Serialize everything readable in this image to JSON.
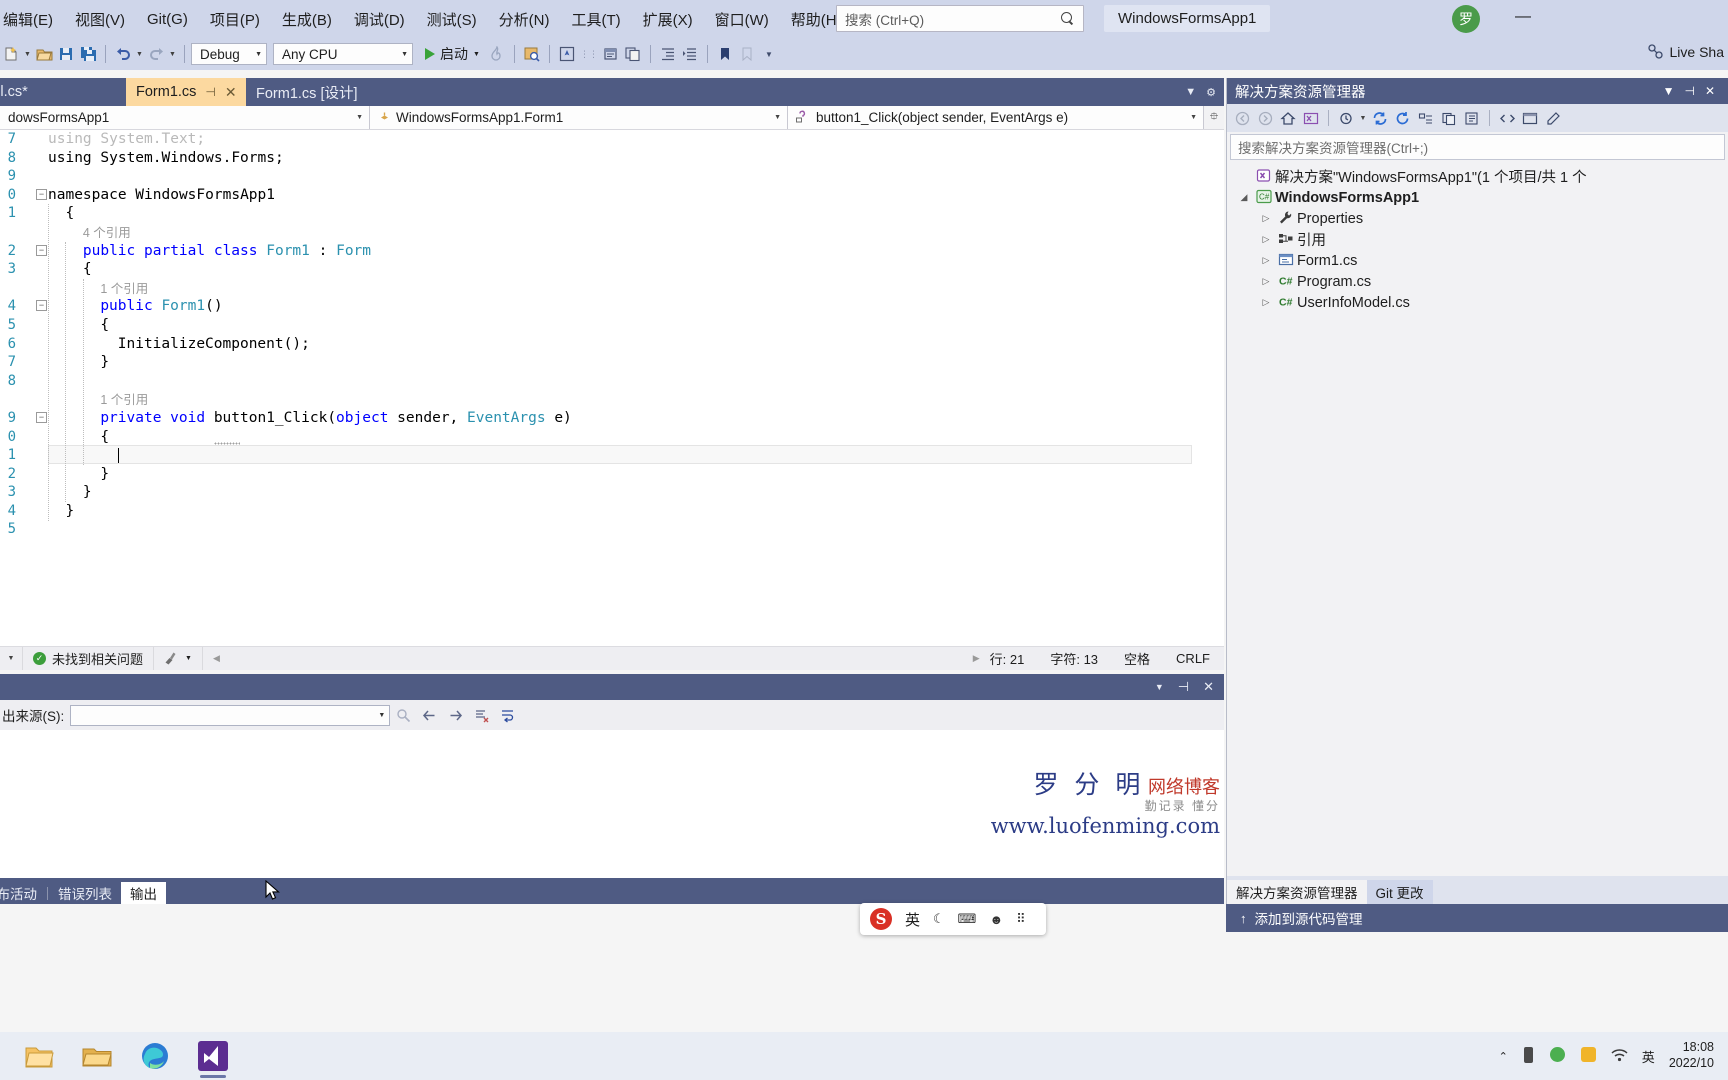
{
  "menubar": {
    "items": [
      {
        "label": "编辑(E)"
      },
      {
        "label": "视图(V)"
      },
      {
        "label": "Git(G)"
      },
      {
        "label": "项目(P)"
      },
      {
        "label": "生成(B)"
      },
      {
        "label": "调试(D)"
      },
      {
        "label": "测试(S)"
      },
      {
        "label": "分析(N)"
      },
      {
        "label": "工具(T)"
      },
      {
        "label": "扩展(X)"
      },
      {
        "label": "窗口(W)"
      },
      {
        "label": "帮助(H)"
      }
    ],
    "search_placeholder": "搜索 (Ctrl+Q)",
    "app_title": "WindowsFormsApp1",
    "user_initial": "罗",
    "minimize": "—"
  },
  "toolbar": {
    "configuration": "Debug",
    "platform": "Any CPU",
    "run_label": "启动",
    "live_share": "Live Sha"
  },
  "doc_tabs": [
    {
      "label": "foModel.cs*",
      "active": false
    },
    {
      "label": "Form1.cs",
      "active": true,
      "pin": "⊣",
      "close": "✕"
    },
    {
      "label": "Form1.cs [设计]",
      "active": false
    }
  ],
  "navbar": {
    "project": "dowsFormsApp1",
    "type": "WindowsFormsApp1.Form1",
    "member": "button1_Click(object sender, EventArgs e)"
  },
  "code": {
    "lines": [
      {
        "num": "7",
        "indent": 0,
        "fold": "",
        "segs": [
          {
            "t": "using System.Text;",
            "c": "gry"
          }
        ],
        "dim": true
      },
      {
        "num": "8",
        "indent": 0,
        "fold": "",
        "segs": [
          {
            "t": "using System.Windows.Forms;",
            "c": "blk"
          }
        ]
      },
      {
        "num": "9",
        "indent": 0,
        "fold": "",
        "segs": []
      },
      {
        "num": "0",
        "indent": 0,
        "fold": "−",
        "segs": [
          {
            "t": "namespace",
            "c": "blk"
          },
          {
            "t": " WindowsFormsApp1",
            "c": "blk"
          }
        ]
      },
      {
        "num": "1",
        "indent": 1,
        "fold": "",
        "segs": [
          {
            "t": "{",
            "c": "blk"
          }
        ]
      },
      {
        "num": "",
        "indent": 2,
        "fold": "",
        "segs": [
          {
            "t": "4 个引用",
            "c": "lens"
          }
        ],
        "lens": true
      },
      {
        "num": "2",
        "indent": 2,
        "fold": "−",
        "segs": [
          {
            "t": "public",
            "c": "kw"
          },
          {
            "t": " ",
            "c": "blk"
          },
          {
            "t": "partial",
            "c": "kw"
          },
          {
            "t": " ",
            "c": "blk"
          },
          {
            "t": "class",
            "c": "kw"
          },
          {
            "t": " ",
            "c": "blk"
          },
          {
            "t": "Form1",
            "c": "typ"
          },
          {
            "t": " : ",
            "c": "blk"
          },
          {
            "t": "Form",
            "c": "typ"
          }
        ]
      },
      {
        "num": "3",
        "indent": 2,
        "fold": "",
        "segs": [
          {
            "t": "{",
            "c": "blk"
          }
        ]
      },
      {
        "num": "",
        "indent": 3,
        "fold": "",
        "segs": [
          {
            "t": "1 个引用",
            "c": "lens"
          }
        ],
        "lens": true
      },
      {
        "num": "4",
        "indent": 3,
        "fold": "−",
        "segs": [
          {
            "t": "public",
            "c": "kw"
          },
          {
            "t": " ",
            "c": "blk"
          },
          {
            "t": "Form1",
            "c": "typ"
          },
          {
            "t": "()",
            "c": "blk"
          }
        ]
      },
      {
        "num": "5",
        "indent": 3,
        "fold": "",
        "segs": [
          {
            "t": "{",
            "c": "blk"
          }
        ]
      },
      {
        "num": "6",
        "indent": 4,
        "fold": "",
        "segs": [
          {
            "t": "InitializeComponent",
            "c": "blk"
          },
          {
            "t": "();",
            "c": "blk"
          }
        ]
      },
      {
        "num": "7",
        "indent": 3,
        "fold": "",
        "segs": [
          {
            "t": "}",
            "c": "blk"
          }
        ]
      },
      {
        "num": "8",
        "indent": 0,
        "fold": "",
        "segs": []
      },
      {
        "num": "",
        "indent": 3,
        "fold": "",
        "segs": [
          {
            "t": "1 个引用",
            "c": "lens"
          }
        ],
        "lens": true
      },
      {
        "num": "9",
        "indent": 3,
        "fold": "−",
        "segs": [
          {
            "t": "private",
            "c": "kw"
          },
          {
            "t": " ",
            "c": "blk"
          },
          {
            "t": "void",
            "c": "kw"
          },
          {
            "t": " ",
            "c": "blk"
          },
          {
            "t": "button1_Click",
            "c": "blk"
          },
          {
            "t": "(",
            "c": "blk"
          },
          {
            "t": "object",
            "c": "kw"
          },
          {
            "t": " sender, ",
            "c": "blk"
          },
          {
            "t": "EventArgs",
            "c": "typ"
          },
          {
            "t": " e)",
            "c": "blk"
          }
        ]
      },
      {
        "num": "0",
        "indent": 3,
        "fold": "",
        "segs": [
          {
            "t": "{",
            "c": "blk"
          }
        ]
      },
      {
        "num": "1",
        "indent": 4,
        "fold": "",
        "segs": [],
        "current": true
      },
      {
        "num": "2",
        "indent": 3,
        "fold": "",
        "segs": [
          {
            "t": "}",
            "c": "blk"
          }
        ]
      },
      {
        "num": "3",
        "indent": 2,
        "fold": "",
        "segs": [
          {
            "t": "}",
            "c": "blk"
          }
        ]
      },
      {
        "num": "4",
        "indent": 1,
        "fold": "",
        "segs": [
          {
            "t": "}",
            "c": "blk"
          }
        ]
      },
      {
        "num": "5",
        "indent": 0,
        "fold": "",
        "segs": []
      }
    ]
  },
  "editor_status": {
    "issue_text": "未找到相关问题",
    "line_label": "行: 21",
    "col_label": "字符: 13",
    "space_label": "空格",
    "eol_label": "CRLF"
  },
  "output_panel": {
    "source_label": "出来源(S):",
    "source_value": "",
    "tabs": [
      {
        "label": "发布活动",
        "selected": false
      },
      {
        "label": "错误列表",
        "selected": false
      },
      {
        "label": "输出",
        "selected": true
      }
    ],
    "watermark": {
      "name": "罗 分 明",
      "blog": "网络博客",
      "tagline": "勤记录 懂分",
      "url": "www.luofenming.com"
    }
  },
  "solution_explorer": {
    "title": "解决方案资源管理器",
    "search_placeholder": "搜索解决方案资源管理器(Ctrl+;)",
    "tree": [
      {
        "label": "解决方案\"WindowsFormsApp1\"(1 个项目/共 1 个",
        "icon": "sln",
        "arrow": "",
        "depth": 0,
        "bold": false
      },
      {
        "label": "WindowsFormsApp1",
        "icon": "cs-proj",
        "arrow": "◢",
        "depth": 0,
        "bold": true
      },
      {
        "label": "Properties",
        "icon": "wrench",
        "arrow": "▷",
        "depth": 1,
        "bold": false
      },
      {
        "label": "引用",
        "icon": "refs",
        "arrow": "▷",
        "depth": 1,
        "bold": false
      },
      {
        "label": "Form1.cs",
        "icon": "form",
        "arrow": "▷",
        "depth": 1,
        "bold": false
      },
      {
        "label": "Program.cs",
        "icon": "cs",
        "arrow": "▷",
        "depth": 1,
        "bold": false
      },
      {
        "label": "UserInfoModel.cs",
        "icon": "cs",
        "arrow": "▷",
        "depth": 1,
        "bold": false
      }
    ],
    "footer_tabs": [
      {
        "label": "解决方案资源管理器",
        "selected": true
      },
      {
        "label": "Git 更改",
        "selected": false
      }
    ]
  },
  "vs_statusbar": {
    "source_control": "添加到源代码管理"
  },
  "ime": {
    "logo": "S",
    "mode": "英",
    "moon": "☾",
    "keyboard": "⌨",
    "person": "☻",
    "grid": "⠿"
  },
  "taskbar": {
    "tray_lang": "英",
    "time": "18:08",
    "date": "2022/10"
  }
}
